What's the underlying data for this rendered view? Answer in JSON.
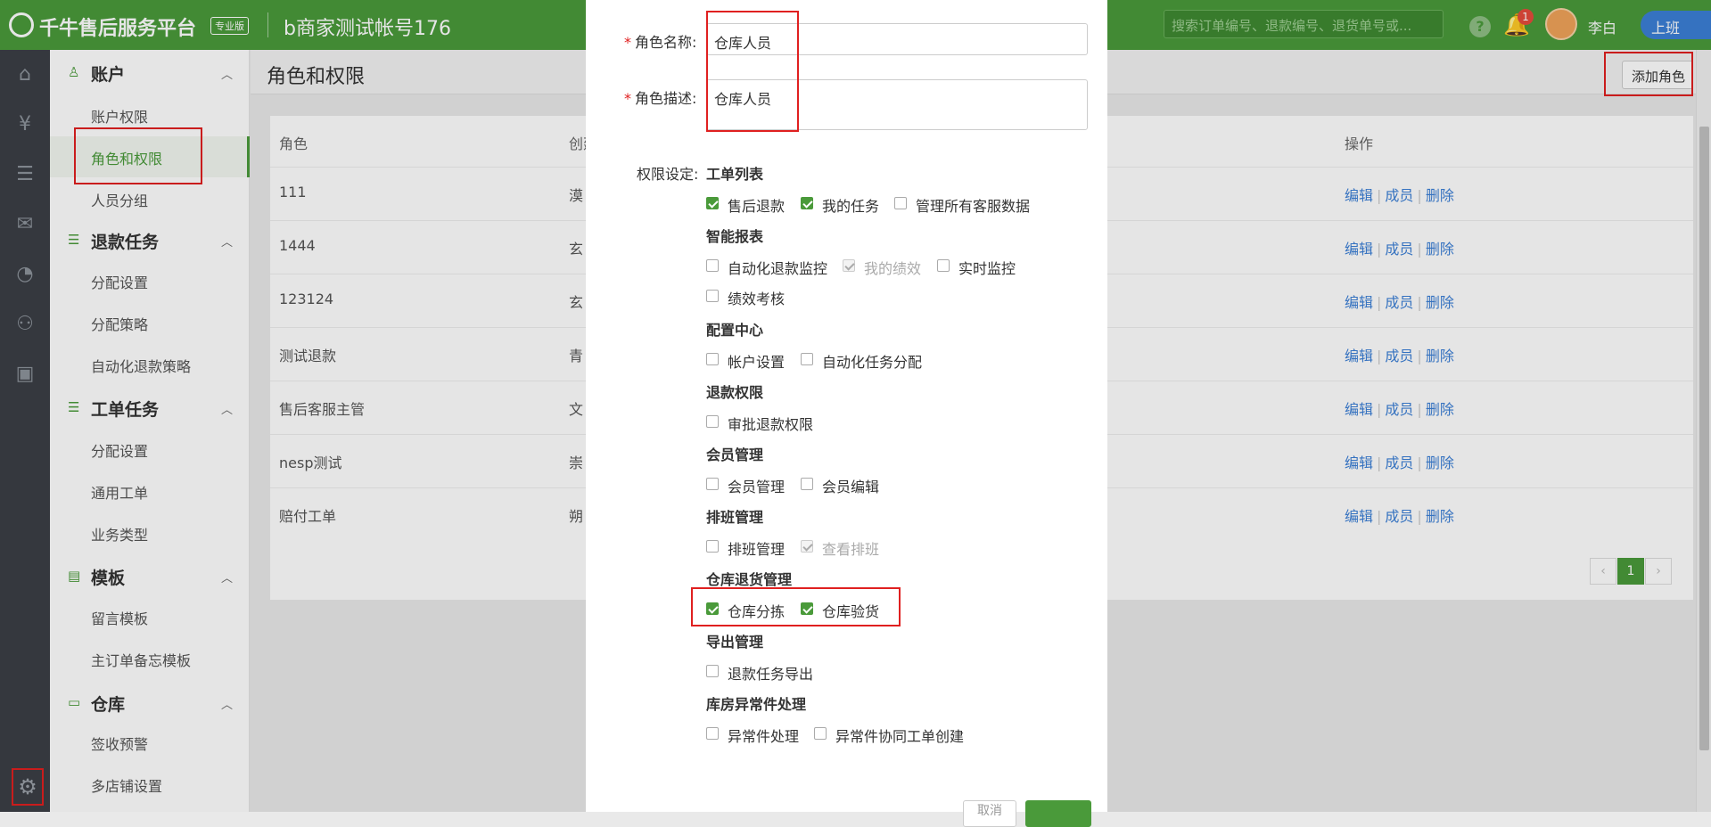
{
  "header": {
    "brand": "千牛售后服务平台",
    "edition": "专业版",
    "account": "b商家测试帐号176",
    "search_placeholder": "搜索订单编号、退款编号、退货单号或...",
    "notification_count": "1",
    "username": "李白",
    "shift_button": "上班",
    "accent_color": "#4a9a3a"
  },
  "rail": {
    "icons": [
      "home-icon",
      "yen-icon",
      "list-icon",
      "ticket-icon",
      "gauge-icon",
      "users-icon",
      "calendar-icon",
      "settings-icon"
    ]
  },
  "sidebar": {
    "groups": [
      {
        "title": "账户",
        "icon": "user-icon",
        "items": [
          "账户权限",
          "角色和权限",
          "人员分组"
        ]
      },
      {
        "title": "退款任务",
        "icon": "list-icon",
        "items": [
          "分配设置",
          "分配策略",
          "自动化退款策略"
        ]
      },
      {
        "title": "工单任务",
        "icon": "list-icon",
        "items": [
          "分配设置",
          "通用工单",
          "业务类型"
        ]
      },
      {
        "title": "模板",
        "icon": "document-icon",
        "items": [
          "留言模板",
          "主订单备忘模板"
        ]
      },
      {
        "title": "仓库",
        "icon": "warehouse-icon",
        "items": [
          "签收预警",
          "多店铺设置"
        ]
      }
    ],
    "active_item": "角色和权限"
  },
  "main": {
    "title": "角色和权限",
    "add_role_button": "添加角色",
    "columns": {
      "role": "角色",
      "creator": "创建人",
      "operations": "操作"
    },
    "rows": [
      {
        "role": "111",
        "creator": "漠"
      },
      {
        "role": "1444",
        "creator": "玄"
      },
      {
        "role": "123124",
        "creator": "玄"
      },
      {
        "role": "测试退款",
        "creator": "青"
      },
      {
        "role": "售后客服主管",
        "creator": "文"
      },
      {
        "role": "nesp测试",
        "creator": "崇"
      },
      {
        "role": "赔付工单",
        "creator": "朔"
      }
    ],
    "op_labels": {
      "edit": "编辑",
      "members": "成员",
      "delete": "删除"
    },
    "pager": {
      "prev": "‹",
      "current": "1",
      "next": "›"
    }
  },
  "modal": {
    "role_name_label": "角色名称",
    "role_name_value": "仓库人员",
    "role_desc_label": "角色描述",
    "role_desc_value": "仓库人员",
    "perm_label": "权限设定:",
    "groups": [
      {
        "title": "工单列表",
        "items": [
          {
            "label": "售后退款",
            "checked": true,
            "disabled": false
          },
          {
            "label": "我的任务",
            "checked": true,
            "disabled": false
          },
          {
            "label": "管理所有客服数据",
            "checked": false,
            "disabled": false
          }
        ]
      },
      {
        "title": "智能报表",
        "items": [
          {
            "label": "自动化退款监控",
            "checked": false,
            "disabled": false
          },
          {
            "label": "我的绩效",
            "checked": true,
            "disabled": true
          },
          {
            "label": "实时监控",
            "checked": false,
            "disabled": false
          },
          {
            "label": "绩效考核",
            "checked": false,
            "disabled": false
          }
        ]
      },
      {
        "title": "配置中心",
        "items": [
          {
            "label": "帐户设置",
            "checked": false,
            "disabled": false
          },
          {
            "label": "自动化任务分配",
            "checked": false,
            "disabled": false
          }
        ]
      },
      {
        "title": "退款权限",
        "items": [
          {
            "label": "审批退款权限",
            "checked": false,
            "disabled": false
          }
        ]
      },
      {
        "title": "会员管理",
        "items": [
          {
            "label": "会员管理",
            "checked": false,
            "disabled": false
          },
          {
            "label": "会员编辑",
            "checked": false,
            "disabled": false
          }
        ]
      },
      {
        "title": "排班管理",
        "items": [
          {
            "label": "排班管理",
            "checked": false,
            "disabled": false
          },
          {
            "label": "查看排班",
            "checked": true,
            "disabled": true
          }
        ]
      },
      {
        "title": "仓库退货管理",
        "items": [
          {
            "label": "仓库分拣",
            "checked": true,
            "disabled": false
          },
          {
            "label": "仓库验货",
            "checked": true,
            "disabled": false
          }
        ]
      },
      {
        "title": "导出管理",
        "items": [
          {
            "label": "退款任务导出",
            "checked": false,
            "disabled": false
          }
        ]
      },
      {
        "title": "库房异常件处理",
        "items": [
          {
            "label": "异常件处理",
            "checked": false,
            "disabled": false
          },
          {
            "label": "异常件协同工单创建",
            "checked": false,
            "disabled": false
          }
        ]
      }
    ],
    "cancel_label": "取消"
  }
}
